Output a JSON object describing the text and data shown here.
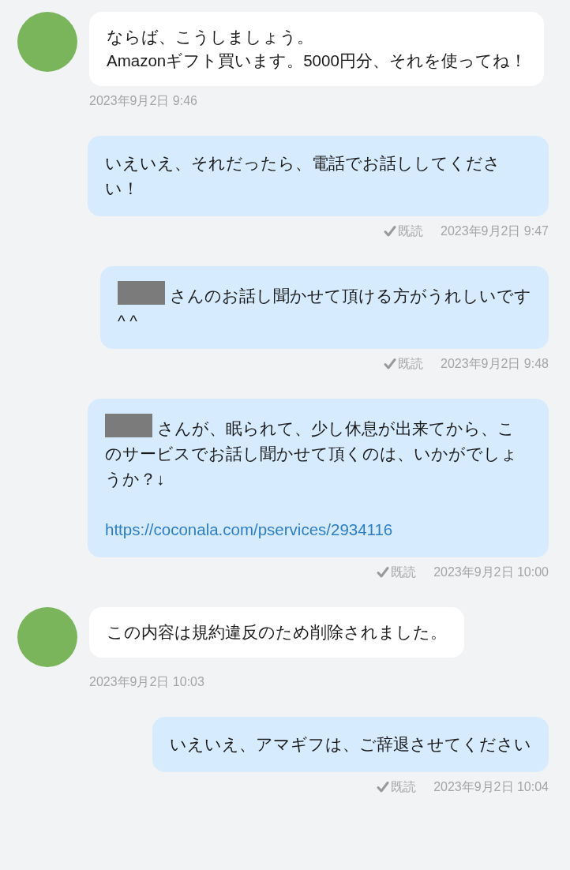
{
  "messages": [
    {
      "kind": "received",
      "redacted": false,
      "text": "ならば、こうしましょう。\nAmazonギフト買います。5000円分、それを使ってね！",
      "time": "2023年9月2日 9:46"
    },
    {
      "kind": "sent",
      "redacted": false,
      "text": "いえいえ、それだったら、電話でお話ししてください！",
      "read": "既読",
      "time": "2023年9月2日 9:47"
    },
    {
      "kind": "sent",
      "redacted": true,
      "text": "さんのお話し聞かせて頂ける方がうれしいです\n^ ^",
      "read": "既読",
      "time": "2023年9月2日 9:48"
    },
    {
      "kind": "sent",
      "redacted": true,
      "text": "さんが、眠られて、少し休息が出来てから、このサービスでお話し聞かせて頂くのは、いかがでしょうか？↓",
      "link": "https://coconala.com/pservices/2934116",
      "read": "既読",
      "time": "2023年9月2日 10:00"
    },
    {
      "kind": "received",
      "redacted": false,
      "text": "この内容は規約違反のため削除されました。",
      "time": "2023年9月2日 10:03"
    },
    {
      "kind": "sent",
      "redacted": false,
      "text": "いえいえ、アマギフは、ご辞退させてください",
      "read": "既読",
      "time": "2023年9月2日 10:04"
    }
  ]
}
